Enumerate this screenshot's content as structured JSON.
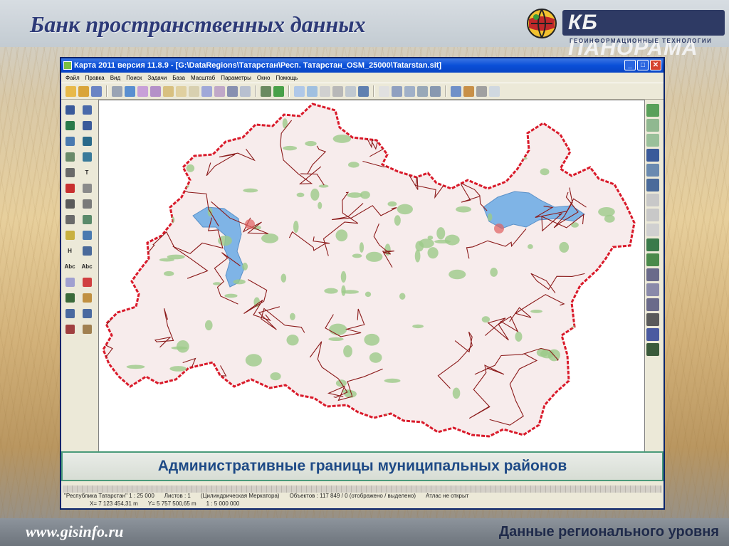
{
  "slide": {
    "title": "Банк пространственных данных",
    "logo_text": "КБ ПАНОРАМА",
    "logo_subtitle": "ГЕОИНФОРМАЦИОННЫЕ ТЕХНОЛОГИИ",
    "caption": "Административные границы муниципальных районов",
    "website": "www.gisinfo.ru",
    "footer_title": "Данные регионального уровня"
  },
  "window": {
    "title": "Карта 2011 версия 11.8.9 - [G:\\DataRegions\\Татарстан\\Респ. Татарстан_OSM_25000\\Tatarstan.sit]",
    "controls": {
      "minimize": "_",
      "maximize": "□",
      "close": "✕"
    },
    "menu": [
      "Файл",
      "Правка",
      "Вид",
      "Поиск",
      "Задачи",
      "База",
      "Масштаб",
      "Параметры",
      "Окно",
      "Помощь"
    ]
  },
  "left_tools": [
    "pen",
    "pen",
    "pen",
    "pen",
    "pen",
    "pen",
    "pin",
    "rect",
    "tree",
    "T",
    "cross",
    "cross",
    "line",
    "fork",
    "fork",
    "stamp",
    "ruler",
    "ruler",
    "H",
    "grid",
    "Abc",
    "Abc",
    "pin",
    "zoom",
    "tree",
    "star",
    "undo",
    "redo",
    "select",
    "gear"
  ],
  "left_tool_labels": {
    "H": "H",
    "T": "T",
    "Abc": "Abc"
  },
  "status": {
    "row1": [
      "\"Республика Татарстан\"  1 : 25 000",
      "Листов : 1",
      "(Цилиндрическая Меркатора)",
      "Объектов : 117 849 / 0 (отображено / выделено)",
      "Атлас не открыт"
    ],
    "row2": [
      "X= 7 123 454,31 m",
      "Y= 5 757 500,65 m",
      "1 : 5 000 000"
    ]
  },
  "colors": {
    "title_text": "#2d3a78",
    "caption_text": "#1e4a86",
    "caption_border": "#4a9a7a",
    "region_border": "#d91a2a",
    "district_border": "#8b1a1a",
    "water": "#7fb4e6",
    "forest": "#9ccb8a",
    "land": "#f7ecec"
  }
}
